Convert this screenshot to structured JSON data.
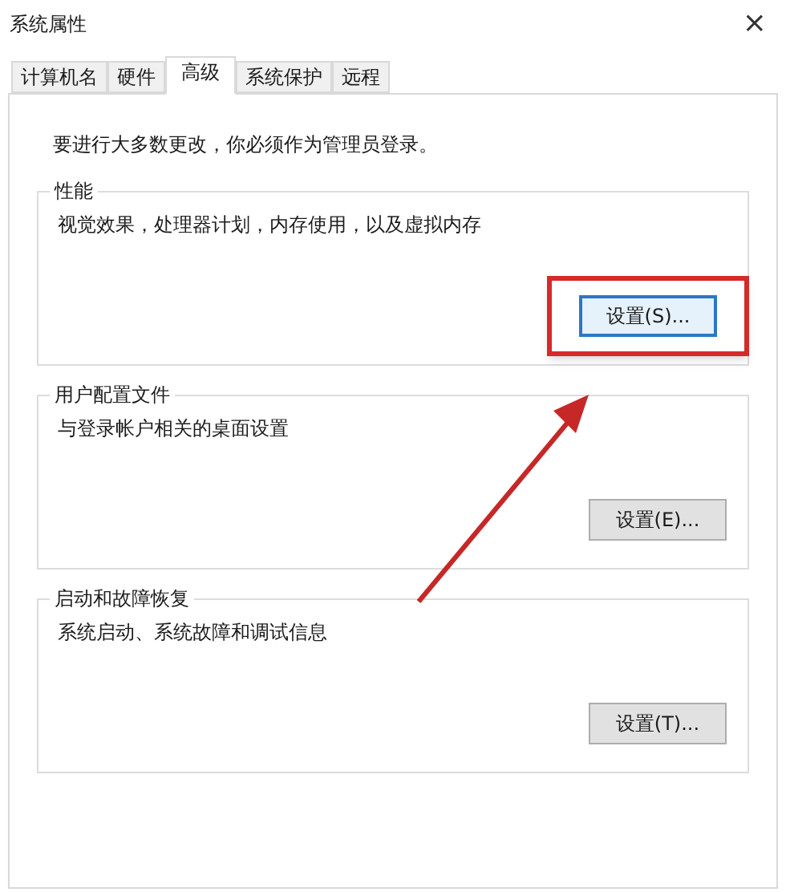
{
  "window": {
    "title": "系统属性",
    "close": "×"
  },
  "tabs": [
    {
      "label": "计算机名",
      "selected": false
    },
    {
      "label": "硬件",
      "selected": false
    },
    {
      "label": "高级",
      "selected": true
    },
    {
      "label": "系统保护",
      "selected": false
    },
    {
      "label": "远程",
      "selected": false
    }
  ],
  "notice": "要进行大多数更改，你必须作为管理员登录。",
  "groups": [
    {
      "title": "性能",
      "description": "视觉效果，处理器计划，内存使用，以及虚拟内存",
      "button": {
        "label": "设置(S)...",
        "focused": true,
        "highlighted": true
      }
    },
    {
      "title": "用户配置文件",
      "description": "与登录帐户相关的桌面设置",
      "button": {
        "label": "设置(E)...",
        "focused": false,
        "highlighted": false
      }
    },
    {
      "title": "启动和故障恢复",
      "description": "系统启动、系统故障和调试信息",
      "button": {
        "label": "设置(T)...",
        "focused": false,
        "highlighted": false
      }
    }
  ]
}
